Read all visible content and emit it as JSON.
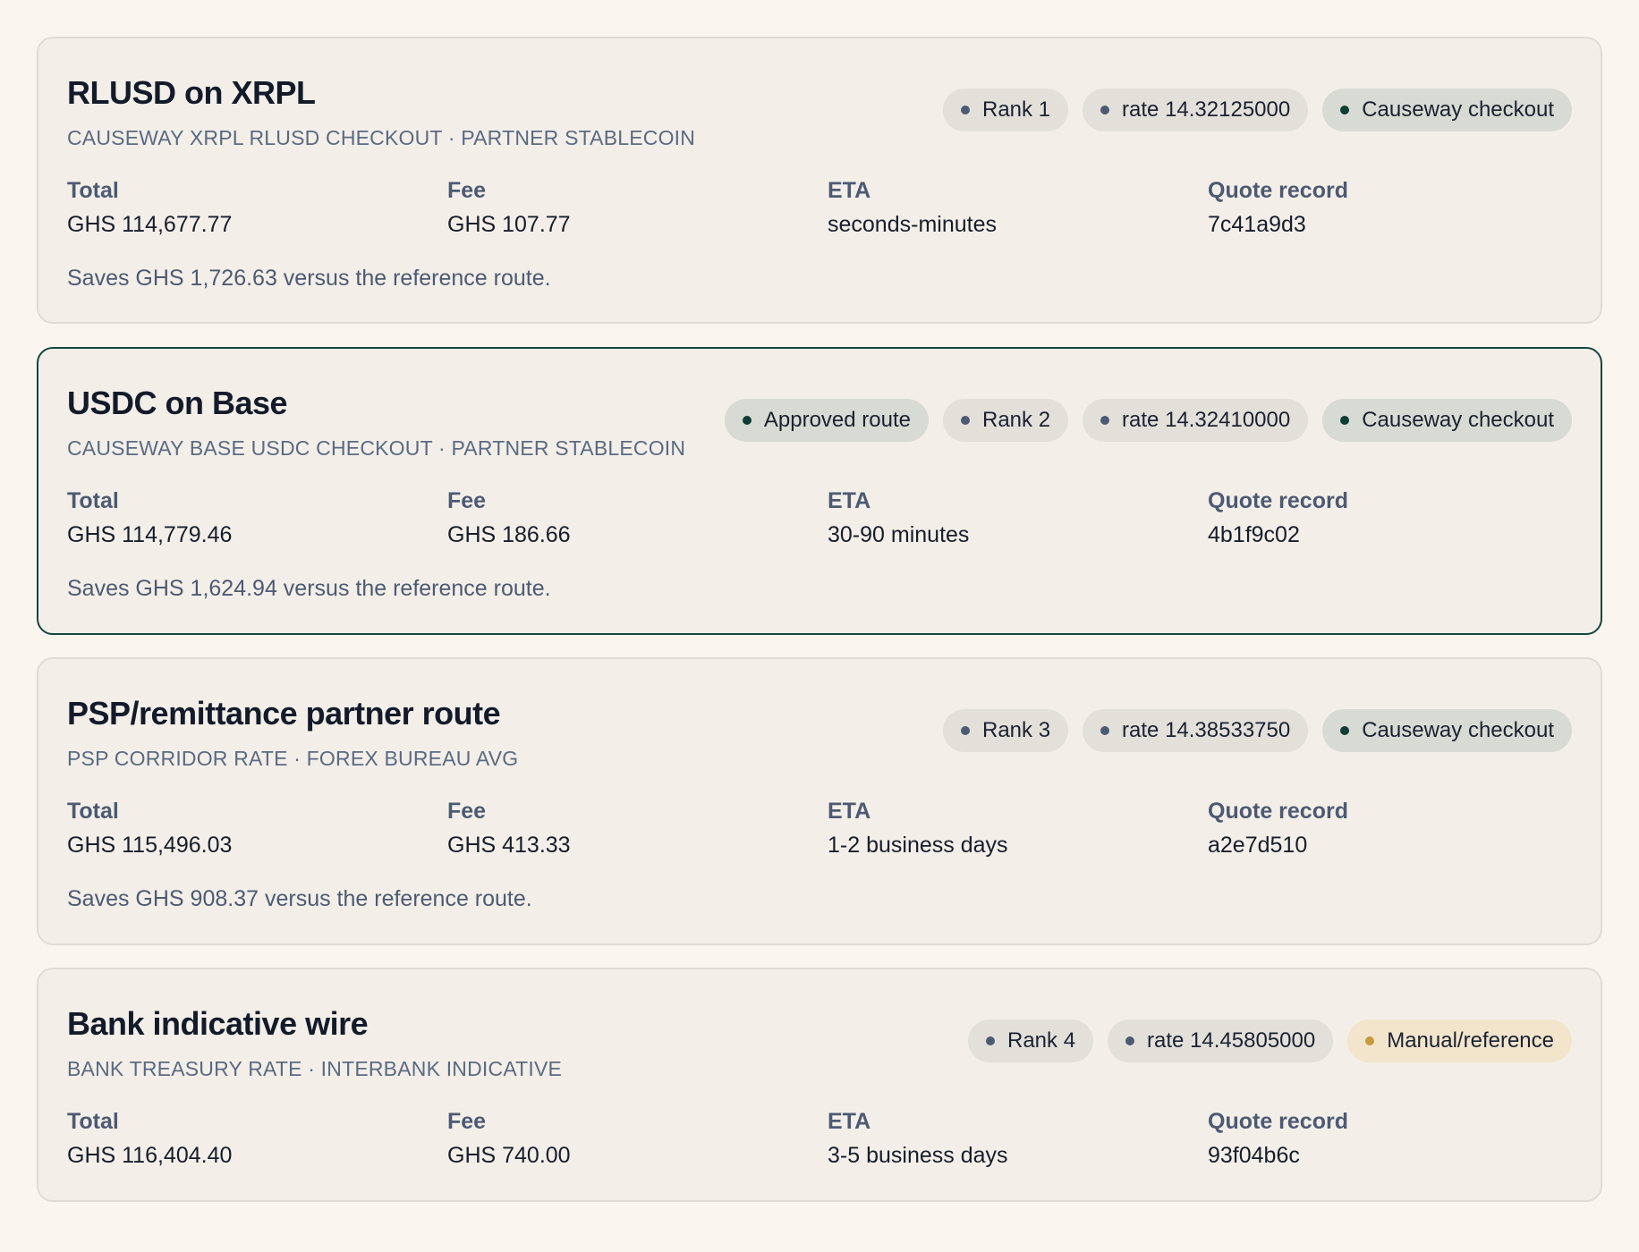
{
  "labels": {
    "total": "Total",
    "fee": "Fee",
    "eta": "ETA",
    "quote_record": "Quote record"
  },
  "colors": {
    "page_bg": "#faf6ef",
    "card_bg": "#f3efe8",
    "selected_border": "#15453e",
    "accent_green": "#0f3d36",
    "accent_amber": "#c79a3c"
  },
  "routes": [
    {
      "title": "RLUSD on XRPL",
      "subtitle": "CAUSEWAY XRPL RLUSD CHECKOUT · PARTNER STABLECOIN",
      "selected": false,
      "badges": [
        {
          "label": "Rank 1",
          "style": "neutral"
        },
        {
          "label": "rate 14.32125000",
          "style": "neutral"
        },
        {
          "label": "Causeway checkout",
          "style": "green"
        }
      ],
      "total": "GHS 114,677.77",
      "fee": "GHS 107.77",
      "eta": "seconds-minutes",
      "quote_record": "7c41a9d3",
      "note": "Saves GHS 1,726.63 versus the reference route."
    },
    {
      "title": "USDC on Base",
      "subtitle": "CAUSEWAY BASE USDC CHECKOUT · PARTNER STABLECOIN",
      "selected": true,
      "badges": [
        {
          "label": "Approved route",
          "style": "green"
        },
        {
          "label": "Rank 2",
          "style": "neutral"
        },
        {
          "label": "rate 14.32410000",
          "style": "neutral"
        },
        {
          "label": "Causeway checkout",
          "style": "green"
        }
      ],
      "total": "GHS 114,779.46",
      "fee": "GHS 186.66",
      "eta": "30-90 minutes",
      "quote_record": "4b1f9c02",
      "note": "Saves GHS 1,624.94 versus the reference route."
    },
    {
      "title": "PSP/remittance partner route",
      "subtitle": "PSP CORRIDOR RATE · FOREX BUREAU AVG",
      "selected": false,
      "badges": [
        {
          "label": "Rank 3",
          "style": "neutral"
        },
        {
          "label": "rate 14.38533750",
          "style": "neutral"
        },
        {
          "label": "Causeway checkout",
          "style": "green"
        }
      ],
      "total": "GHS 115,496.03",
      "fee": "GHS 413.33",
      "eta": "1-2 business days",
      "quote_record": "a2e7d510",
      "note": "Saves GHS 908.37 versus the reference route."
    },
    {
      "title": "Bank indicative wire",
      "subtitle": "BANK TREASURY RATE · INTERBANK INDICATIVE",
      "selected": false,
      "badges": [
        {
          "label": "Rank 4",
          "style": "neutral"
        },
        {
          "label": "rate 14.45805000",
          "style": "neutral"
        },
        {
          "label": "Manual/reference",
          "style": "amber"
        }
      ],
      "total": "GHS 116,404.40",
      "fee": "GHS 740.00",
      "eta": "3-5 business days",
      "quote_record": "93f04b6c",
      "note": ""
    }
  ]
}
